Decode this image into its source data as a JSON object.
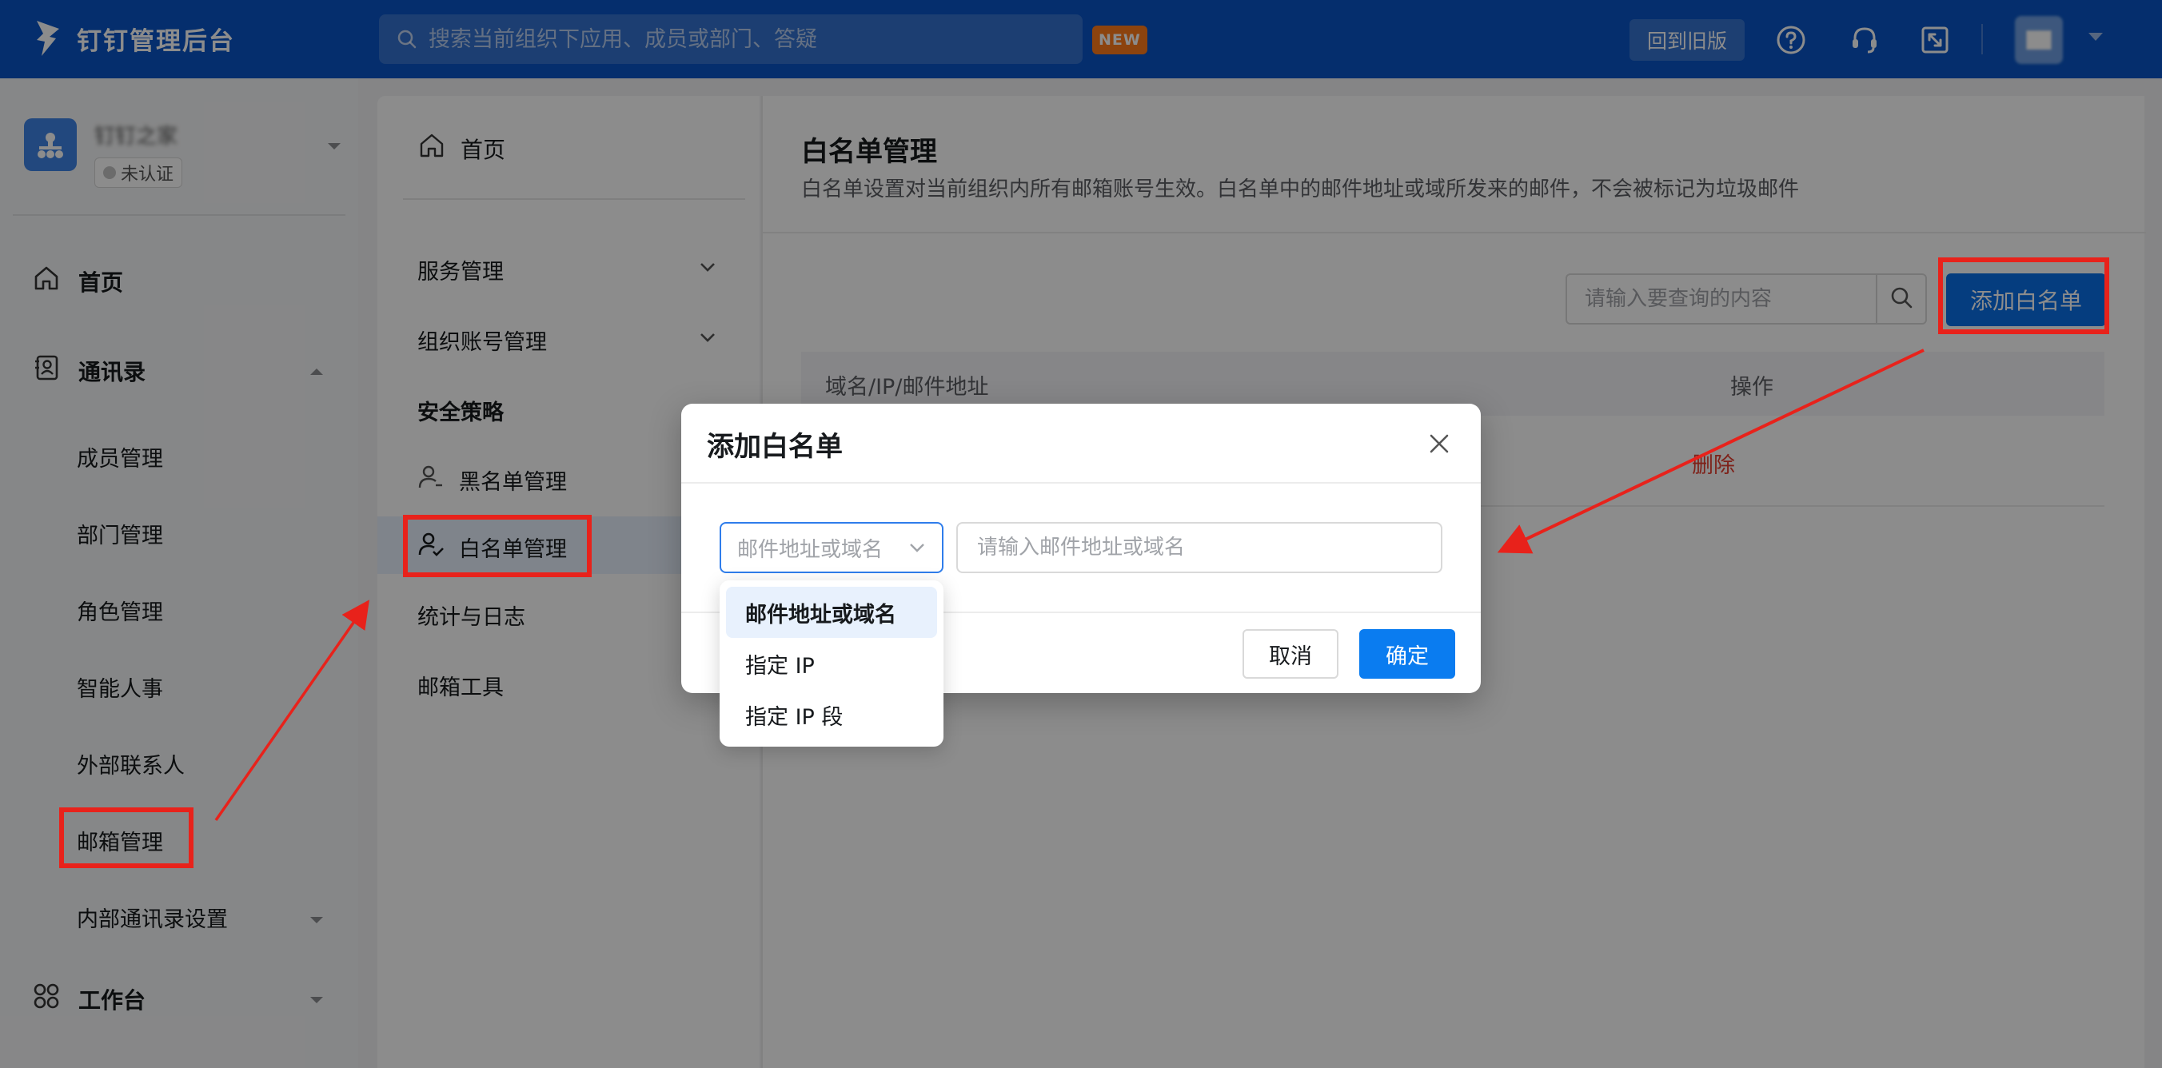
{
  "topbar": {
    "brand": "钉钉管理后台",
    "search_placeholder": "搜索当前组织下应用、成员或部门、答疑",
    "new_badge": "NEW",
    "back_old": "回到旧版",
    "avatar_text": "██"
  },
  "sidebar": {
    "org_name": "钉钉之家",
    "org_status": "未认证",
    "home": "首页",
    "contacts": "通讯录",
    "sub_items": [
      "成员管理",
      "部门管理",
      "角色管理",
      "智能人事",
      "外部联系人",
      "邮箱管理",
      "内部通讯录设置"
    ],
    "workbench": "工作台"
  },
  "submenu": {
    "home": "首页",
    "items": [
      {
        "label": "服务管理"
      },
      {
        "label": "组织账号管理"
      },
      {
        "label": "安全策略"
      },
      {
        "label": "黑名单管理"
      },
      {
        "label": "白名单管理"
      },
      {
        "label": "统计与日志"
      },
      {
        "label": "邮箱工具"
      }
    ]
  },
  "main": {
    "title": "白名单管理",
    "description": "白名单设置对当前组织内所有邮箱账号生效。白名单中的邮件地址或域所发来的邮件，不会被标记为垃圾邮件",
    "search_placeholder": "请输入要查询的内容",
    "add_button": "添加白名单",
    "table_headers": [
      "域名/IP/邮件地址",
      "操作"
    ],
    "rows": [
      {
        "action": "删除"
      }
    ]
  },
  "modal": {
    "title": "添加白名单",
    "select_placeholder": "邮件地址或域名",
    "input_placeholder": "请输入邮件地址或域名",
    "cancel": "取消",
    "confirm": "确定",
    "options": [
      "邮件地址或域名",
      "指定 IP",
      "指定 IP 段"
    ],
    "selected_option": "邮件地址或域名"
  },
  "colors": {
    "topbar": "#0a55c6",
    "primary": "#0a7cf0",
    "danger": "#e63c2e",
    "annotation": "#e8221b"
  }
}
